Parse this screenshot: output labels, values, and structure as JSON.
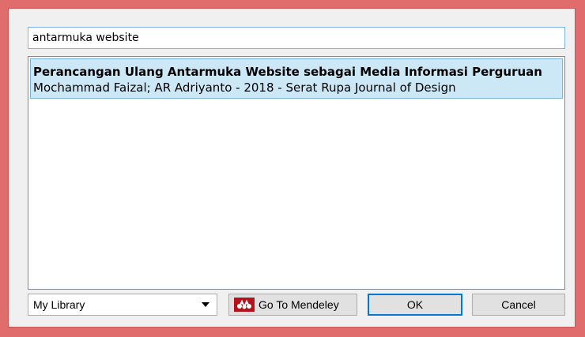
{
  "search": {
    "value": "antarmuka website"
  },
  "results": [
    {
      "title": "Perancangan Ulang Antarmuka Website sebagai Media Informasi Perguruan",
      "meta": "Mochammad Faizal; AR Adriyanto - 2018 - Serat Rupa Journal of Design",
      "selected": true
    }
  ],
  "footer": {
    "library_selected": "My Library",
    "mendeley_button": "Go To Mendeley",
    "ok_button": "OK",
    "cancel_button": "Cancel"
  },
  "icons": {
    "mendeley": "mendeley-logo-icon",
    "dropdown": "chevron-down-icon"
  },
  "colors": {
    "window_border": "#e06c6c",
    "selection_bg": "#cce8f7",
    "selection_border": "#7ab3dc",
    "mendeley_red": "#b3131b",
    "focus_blue": "#0078d7"
  }
}
